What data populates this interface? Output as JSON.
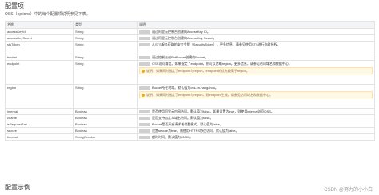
{
  "page": {
    "title": "配置项",
    "description": "OSS（options）中的每个配置项说明参见下表。",
    "example_title": "配置示例",
    "watermark": "CSDN @努力的小小白"
  },
  "table": {
    "headers": [
      "名称",
      "类型",
      "说明"
    ],
    "rows": [
      {
        "name": "accessKeyId",
        "type": "String",
        "desc": "通过阿里云控制台创建的AccessKey ID。",
        "tip": ""
      },
      {
        "name": "accessKeySecret",
        "type": "String",
        "desc": "通过阿里云控制台创建的AccessKey Secret。",
        "tip": ""
      },
      {
        "name": "stsToken",
        "type": "String",
        "desc": "从STS服务获取的安全令牌（SecurityToken）。更多信息，请参见使用STS进行临时授权。",
        "tip": ""
      },
      {
        "name": "bucket",
        "type": "String",
        "desc": "通过控制台或PutBucket创建的Bucket。",
        "tip": ""
      },
      {
        "name": "endpoint",
        "type": "String",
        "desc": "OSS访问域名。如果指定了endpoint，则可以忽略region。更多信息，请参见访问域名和数据中心。",
        "tip": "说明：如果同时指定了endpoint与region，endpoint的优先级高于region。"
      },
      {
        "name": "region",
        "type": "String",
        "desc": "Bucket所在地域。默认值为oss-cn-hangzhou。",
        "tip": "说明：如果同时指定了endpoint与region，则endpoint生效。请参见访问域名和数据中心。"
      },
      {
        "name": "internal",
        "type": "Boolean",
        "desc": "是否使用阿里云内网访问。默认值为false。如果设置为true，则使用internal访问OSS。",
        "tip": ""
      },
      {
        "name": "cname",
        "type": "Boolean",
        "desc": "是否支持自定义域名访问。默认值为false。",
        "tip": ""
      },
      {
        "name": "isRequestPay",
        "type": "Boolean",
        "desc": "Bucket是否开启请求者付费模式。默认值为false。",
        "tip": ""
      },
      {
        "name": "secure",
        "type": "Boolean",
        "desc": "设置secure为true，则使用HTTPS协议访问。默认值为false。",
        "tip": ""
      },
      {
        "name": "timeout",
        "type": "String|Number",
        "desc": "超时时间，默认值为60000。",
        "tip": ""
      }
    ]
  },
  "colors": {
    "accent": "#3377ff",
    "tip_bg": "#fff8e6",
    "header_bg": "#f3f4f6"
  }
}
